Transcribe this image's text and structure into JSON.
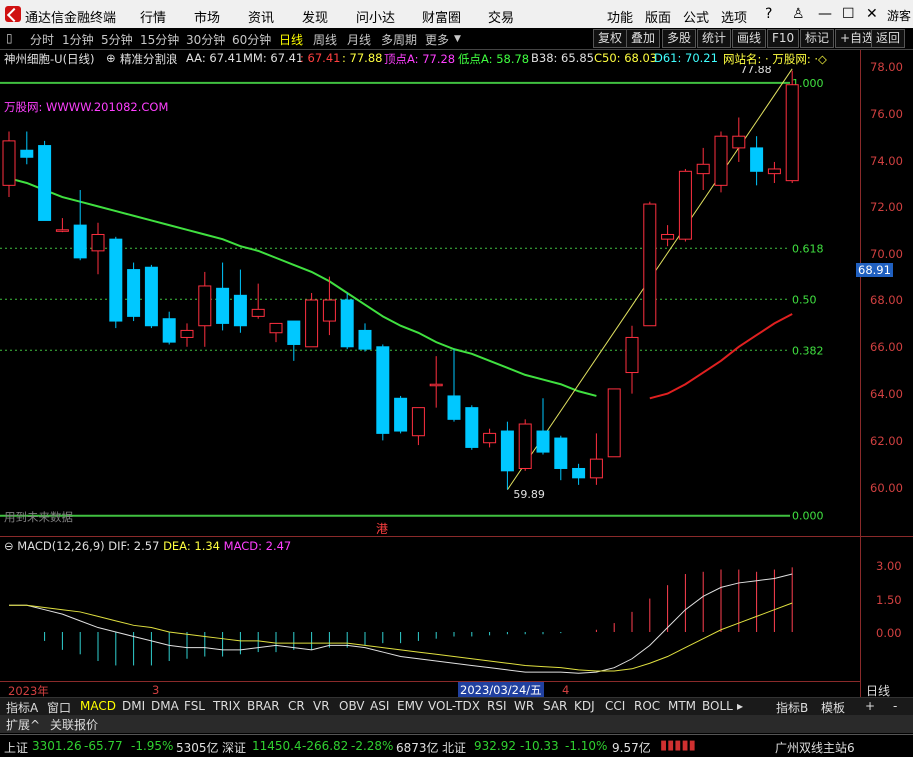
{
  "menubar": {
    "app_title": "通达信金融终端",
    "items": [
      "行情",
      "市场",
      "资讯",
      "发现",
      "问小达",
      "财富圈",
      "交易"
    ],
    "right_items": [
      "功能",
      "版面",
      "公式",
      "选项"
    ],
    "user": "游客"
  },
  "toolbar": {
    "periods": [
      "分时",
      "1分钟",
      "5分钟",
      "15分钟",
      "30分钟",
      "60分钟",
      "日线",
      "周线",
      "月线",
      "多周期",
      "更多"
    ],
    "selected_period": "日线",
    "right_buttons": [
      "复权",
      "叠加",
      "多股",
      "统计",
      "画线",
      "F10",
      "标记",
      "+自选",
      "返回"
    ]
  },
  "info": {
    "stock": "神州细胞-U(日线)",
    "mode": "精准分割浪",
    "aa": "AA: 67.41",
    "mm": "MM: 67.41",
    "v3": ": 67.41",
    "v4": ": 77.88",
    "top": "顶点A: 77.28",
    "low": "低点A: 58.78",
    "b38": "B38: 65.85",
    "c50": "C50: 68.03",
    "d61": "D61: 70.21",
    "site": "网站名: · 万股网: ·◇"
  },
  "chart_annotations": {
    "website": "万股网: WWWW.201082.COM",
    "high_label": "77.88",
    "low_label": "59.89",
    "future_text": "用到未来数据",
    "gang": "港",
    "fib_1000": "1.000",
    "fib_0618": "0.618",
    "fib_050": "0.50",
    "fib_0382": "0.382",
    "fib_0000": "0.000",
    "current_price": "68.91"
  },
  "price_axis": [
    "78.00",
    "76.00",
    "74.00",
    "72.00",
    "70.00",
    "68.00",
    "66.00",
    "64.00",
    "62.00",
    "60.00"
  ],
  "macd": {
    "label": "MACD(12,26,9)",
    "dif": "DIF: 2.57",
    "dea": "DEA: 1.34",
    "macd": "MACD: 2.47",
    "axis": [
      "3.00",
      "1.50",
      "0.00"
    ]
  },
  "timeline": {
    "year": "2023年",
    "m3": "3",
    "date": "2023/03/24/五",
    "m4": "4",
    "period_btn": "日线"
  },
  "tabs": [
    "指标A",
    "窗口",
    "MACD",
    "DMI",
    "DMA",
    "FSL",
    "TRIX",
    "BRAR",
    "CR",
    "VR",
    "OBV",
    "ASI",
    "EMV",
    "VOL-TDX",
    "RSI",
    "WR",
    "SAR",
    "KDJ",
    "CCI",
    "ROC",
    "MTM",
    "BOLL"
  ],
  "tabs_selected": "MACD",
  "tabs_right": [
    "指标B",
    "模板",
    "+",
    "-"
  ],
  "tabs2": [
    "扩展^",
    "关联报价"
  ],
  "status": {
    "sh_name": "上证",
    "sh_val": "3301.26",
    "sh_chg": "-65.77",
    "sh_pct": "-1.95%",
    "sh_amt": "5305亿",
    "sz_name": "深证",
    "sz_val": "11450.4",
    "sz_chg": "-266.82",
    "sz_pct": "-2.28%",
    "sz_amt": "6873亿",
    "bj_name": "北证",
    "bj_val": "932.92",
    "bj_chg": "-10.33",
    "bj_pct": "-1.10%",
    "bj_amt": "9.57亿",
    "server": "广州双线主站6"
  },
  "colors": {
    "up": "#ff3040",
    "down": "#00c8ff",
    "ma": "#40e040",
    "ma2": "#e02020",
    "fib": "#40c040"
  },
  "chart_data": {
    "type": "candlestick",
    "ylim": [
      59.0,
      78.6
    ],
    "candles": [
      {
        "o": 72.9,
        "c": 74.8,
        "h": 75.2,
        "l": 72.4
      },
      {
        "o": 74.4,
        "c": 74.1,
        "h": 75.2,
        "l": 73.8
      },
      {
        "o": 74.6,
        "c": 71.4,
        "h": 74.8,
        "l": 71.4
      },
      {
        "o": 71.0,
        "c": 71.0,
        "h": 71.5,
        "l": 70.9
      },
      {
        "o": 71.2,
        "c": 69.8,
        "h": 72.7,
        "l": 69.7
      },
      {
        "o": 70.1,
        "c": 70.8,
        "h": 71.3,
        "l": 69.1
      },
      {
        "o": 70.6,
        "c": 67.1,
        "h": 70.7,
        "l": 66.8
      },
      {
        "o": 69.3,
        "c": 67.3,
        "h": 69.6,
        "l": 67.1
      },
      {
        "o": 69.4,
        "c": 66.9,
        "h": 69.5,
        "l": 66.8
      },
      {
        "o": 67.2,
        "c": 66.2,
        "h": 67.5,
        "l": 66.1
      },
      {
        "o": 66.4,
        "c": 66.7,
        "h": 67.0,
        "l": 66.0
      },
      {
        "o": 66.9,
        "c": 68.6,
        "h": 69.2,
        "l": 66.0
      },
      {
        "o": 68.5,
        "c": 67.0,
        "h": 69.6,
        "l": 66.7
      },
      {
        "o": 68.2,
        "c": 66.9,
        "h": 69.3,
        "l": 66.6
      },
      {
        "o": 67.3,
        "c": 67.6,
        "h": 68.7,
        "l": 67.2
      },
      {
        "o": 66.6,
        "c": 67.0,
        "h": 67.0,
        "l": 66.2
      },
      {
        "o": 67.1,
        "c": 66.1,
        "h": 67.1,
        "l": 65.4
      },
      {
        "o": 66.0,
        "c": 68.0,
        "h": 68.3,
        "l": 66.0
      },
      {
        "o": 67.1,
        "c": 68.0,
        "h": 69.0,
        "l": 66.5
      },
      {
        "o": 68.0,
        "c": 66.0,
        "h": 68.3,
        "l": 65.9
      },
      {
        "o": 66.7,
        "c": 65.9,
        "h": 67.0,
        "l": 65.8
      },
      {
        "o": 66.0,
        "c": 62.3,
        "h": 66.1,
        "l": 62.0
      },
      {
        "o": 63.8,
        "c": 62.4,
        "h": 63.9,
        "l": 62.3
      },
      {
        "o": 62.2,
        "c": 63.4,
        "h": 63.4,
        "l": 61.8
      },
      {
        "o": 64.4,
        "c": 64.4,
        "h": 65.6,
        "l": 63.4
      },
      {
        "o": 63.9,
        "c": 62.9,
        "h": 65.9,
        "l": 62.8
      },
      {
        "o": 63.4,
        "c": 61.7,
        "h": 63.5,
        "l": 61.6
      },
      {
        "o": 61.9,
        "c": 62.3,
        "h": 62.5,
        "l": 61.7
      },
      {
        "o": 62.4,
        "c": 60.7,
        "h": 62.8,
        "l": 59.9
      },
      {
        "o": 60.8,
        "c": 62.7,
        "h": 62.9,
        "l": 60.7
      },
      {
        "o": 62.4,
        "c": 61.5,
        "h": 63.8,
        "l": 61.4
      },
      {
        "o": 62.1,
        "c": 60.8,
        "h": 62.2,
        "l": 60.3
      },
      {
        "o": 60.8,
        "c": 60.4,
        "h": 61.0,
        "l": 60.1
      },
      {
        "o": 60.4,
        "c": 61.2,
        "h": 62.3,
        "l": 60.1
      },
      {
        "o": 61.3,
        "c": 64.2,
        "h": 64.2,
        "l": 61.3
      },
      {
        "o": 64.9,
        "c": 66.4,
        "h": 66.9,
        "l": 64.0
      },
      {
        "o": 66.9,
        "c": 72.1,
        "h": 72.2,
        "l": 66.9
      },
      {
        "o": 70.6,
        "c": 70.8,
        "h": 71.2,
        "l": 70.3
      },
      {
        "o": 70.6,
        "c": 73.5,
        "h": 73.6,
        "l": 70.5
      },
      {
        "o": 73.4,
        "c": 73.8,
        "h": 74.5,
        "l": 72.7
      },
      {
        "o": 72.9,
        "c": 75.0,
        "h": 75.2,
        "l": 72.6
      },
      {
        "o": 74.5,
        "c": 75.0,
        "h": 75.8,
        "l": 73.9
      },
      {
        "o": 74.5,
        "c": 73.5,
        "h": 75.0,
        "l": 72.9
      },
      {
        "o": 73.4,
        "c": 73.6,
        "h": 73.9,
        "l": 73.0
      },
      {
        "o": 73.1,
        "c": 77.2,
        "h": 77.8,
        "l": 73.0
      }
    ],
    "ma": [
      null,
      null,
      null,
      null,
      null,
      null,
      null,
      null,
      null,
      null,
      null,
      null,
      null,
      null,
      null,
      null,
      null,
      null,
      null,
      null,
      null,
      null,
      null,
      null,
      null,
      null,
      null,
      null,
      null,
      null,
      null,
      null,
      null,
      null,
      null,
      null,
      63.8,
      64.0,
      64.4,
      64.9,
      65.4,
      66.0,
      66.5,
      67.0,
      67.4
    ],
    "ma_green": [
      73.2,
      73.0,
      72.7,
      72.4,
      72.2,
      72.0,
      71.8,
      71.6,
      71.4,
      71.2,
      71.0,
      70.8,
      70.6,
      70.3,
      70.1,
      69.8,
      69.5,
      69.2,
      68.8,
      68.3,
      67.8,
      67.3,
      66.9,
      66.6,
      66.2,
      65.9,
      65.7,
      65.4,
      65.1,
      64.8,
      64.6,
      64.4,
      64.1,
      63.9
    ],
    "macd_hist": [
      0.0,
      0.0,
      -0.4,
      -0.8,
      -1.0,
      -1.3,
      -1.5,
      -1.5,
      -1.5,
      -1.3,
      -1.2,
      -1.1,
      -1.1,
      -1.0,
      -0.9,
      -0.9,
      -0.8,
      -0.8,
      -0.7,
      -0.7,
      -0.6,
      -0.5,
      -0.5,
      -0.4,
      -0.3,
      -0.2,
      -0.2,
      -0.15,
      -0.1,
      -0.1,
      -0.1,
      -0.05,
      0.0,
      0.1,
      0.4,
      0.9,
      1.5,
      2.1,
      2.6,
      2.7,
      2.8,
      2.8,
      2.7,
      2.8,
      2.9
    ],
    "dif": [
      1.2,
      1.2,
      1.0,
      0.8,
      0.5,
      0.2,
      0.0,
      -0.2,
      -0.4,
      -0.6,
      -0.7,
      -0.7,
      -0.8,
      -0.8,
      -0.7,
      -0.6,
      -0.7,
      -0.8,
      -0.6,
      -0.6,
      -0.7,
      -0.9,
      -1.1,
      -1.2,
      -1.3,
      -1.4,
      -1.5,
      -1.6,
      -1.7,
      -1.8,
      -1.8,
      -1.8,
      -1.85,
      -1.8,
      -1.6,
      -1.2,
      -0.6,
      0.2,
      1.0,
      1.6,
      2.0,
      2.2,
      2.3,
      2.4,
      2.6
    ],
    "dea": [
      1.2,
      1.2,
      1.1,
      1.0,
      0.9,
      0.7,
      0.5,
      0.3,
      0.2,
      0.0,
      -0.1,
      -0.2,
      -0.3,
      -0.4,
      -0.4,
      -0.5,
      -0.5,
      -0.5,
      -0.5,
      -0.5,
      -0.6,
      -0.7,
      -0.8,
      -0.9,
      -1.0,
      -1.1,
      -1.2,
      -1.3,
      -1.4,
      -1.5,
      -1.55,
      -1.6,
      -1.7,
      -1.75,
      -1.75,
      -1.65,
      -1.4,
      -1.1,
      -0.7,
      -0.3,
      0.1,
      0.4,
      0.7,
      1.0,
      1.3
    ]
  }
}
